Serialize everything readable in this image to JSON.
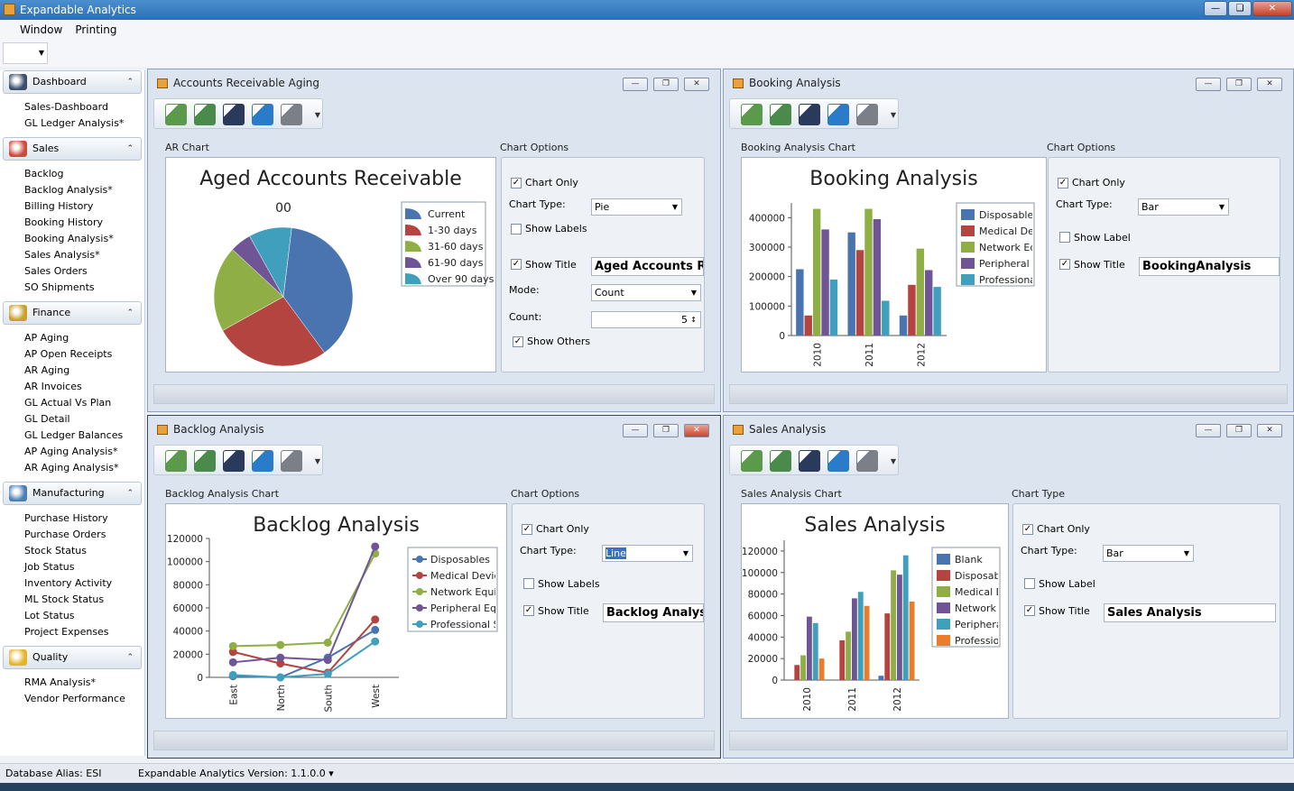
{
  "app": {
    "title": "Expandable Analytics"
  },
  "menu": [
    "Window",
    "Printing"
  ],
  "nav": [
    {
      "header": "Dashboard",
      "color": "#3b4f6b",
      "icon": "dashboard-gauge-icon",
      "items": [
        "Sales-Dashboard",
        "GL Ledger Analysis*"
      ]
    },
    {
      "header": "Sales",
      "color": "#d04a3a",
      "icon": "sales-bars-icon",
      "items": [
        "Backlog",
        "Backlog Analysis*",
        "Billing History",
        "Booking History",
        "Booking Analysis*",
        "Sales Analysis*",
        "Sales Orders",
        "SO Shipments"
      ]
    },
    {
      "header": "Finance",
      "color": "#c9a02b",
      "icon": "finance-money-icon",
      "items": [
        "AP Aging",
        "AP Open Receipts",
        "AR Aging",
        "AR Invoices",
        "GL Actual Vs Plan",
        "GL Detail",
        "GL Ledger Balances",
        "AP Aging Analysis*",
        "AR Aging Analysis*"
      ]
    },
    {
      "header": "Manufacturing",
      "color": "#4a7fb5",
      "icon": "manufacturing-gear-icon",
      "items": [
        "Purchase History",
        "Purchase Orders",
        "Stock Status",
        "Job Status",
        "Inventory Activity",
        "ML Stock Status",
        "Lot Status",
        "Project Expenses"
      ]
    },
    {
      "header": "Quality",
      "color": "#e2b52b",
      "icon": "quality-star-icon",
      "items": [
        "RMA Analysis*",
        "Vendor Performance"
      ]
    }
  ],
  "status": {
    "db": "Database Alias: ESI",
    "version": "Expandable Analytics Version: 1.1.0.0 ▾"
  },
  "windows": {
    "ar": {
      "title": "Accounts Receivable Aging",
      "chart_label": "AR Chart",
      "options_label": "Chart Options",
      "options": {
        "chart_only": "Chart Only",
        "chart_type_label": "Chart Type:",
        "chart_type": "Pie",
        "show_labels": "Show Labels",
        "show_title": "Show Title",
        "title_value": "Aged Accounts Rec",
        "mode_label": "Mode:",
        "mode": "Count",
        "count_label": "Count:",
        "count": "5",
        "show_others": "Show Others"
      }
    },
    "booking": {
      "title": "Booking Analysis",
      "chart_label": "Booking Analysis Chart",
      "options_label": "Chart Options",
      "options": {
        "chart_only": "Chart Only",
        "chart_type_label": "Chart Type:",
        "chart_type": "Bar",
        "show_label": "Show Label",
        "show_title": "Show Title",
        "title_value": "BookingAnalysis"
      }
    },
    "backlog": {
      "title": "Backlog Analysis",
      "chart_label": "Backlog Analysis Chart",
      "options_label": "Chart Options",
      "options": {
        "chart_only": "Chart Only",
        "chart_type_label": "Chart Type:",
        "chart_type": "Line",
        "show_labels": "Show Labels",
        "show_title": "Show Title",
        "title_value": "Backlog Analysis"
      }
    },
    "sales": {
      "title": "Sales Analysis",
      "chart_label": "Sales Analysis Chart",
      "options_label": "Chart Type",
      "options": {
        "chart_only": "Chart Only",
        "chart_type_label": "Chart Type:",
        "chart_type": "Bar",
        "show_label": "Show Label",
        "show_title": "Show Title",
        "title_value": "Sales Analysis"
      }
    }
  },
  "chart_data": [
    {
      "type": "pie",
      "title": "Aged Accounts Receivable",
      "subtitle": "00",
      "categories": [
        "Current",
        "1-30 days",
        "31-60 days",
        "61-90 days",
        "Over 90 days"
      ],
      "values": [
        38,
        27,
        20,
        5,
        10
      ],
      "colors": [
        "#4a74b0",
        "#b4443f",
        "#8fae45",
        "#6f5596",
        "#3f9fbd"
      ],
      "legend": "right"
    },
    {
      "type": "bar",
      "title": "Booking Analysis",
      "categories": [
        "2010",
        "2011",
        "2012"
      ],
      "ylim": [
        0,
        450000
      ],
      "yticks": [
        "0",
        "100000",
        "200000",
        "300000",
        "400000"
      ],
      "series": [
        {
          "name": "Disposables",
          "values": [
            225000,
            350000,
            68000
          ],
          "color": "#4a74b0"
        },
        {
          "name": "Medical Devi",
          "values": [
            68000,
            290000,
            172000
          ],
          "color": "#b4443f"
        },
        {
          "name": "Network Equ",
          "values": [
            430000,
            430000,
            295000
          ],
          "color": "#8fae45"
        },
        {
          "name": "Peripheral Ec",
          "values": [
            360000,
            395000,
            222000
          ],
          "color": "#6f5596"
        },
        {
          "name": "Professional",
          "values": [
            190000,
            118000,
            165000
          ],
          "color": "#3f9fbd"
        }
      ],
      "legend": "right"
    },
    {
      "type": "line",
      "title": "Backlog Analysis",
      "categories": [
        "East",
        "North",
        "South",
        "West"
      ],
      "ylim": [
        0,
        120000
      ],
      "yticks": [
        "0",
        "20000",
        "40000",
        "60000",
        "80000",
        "100000",
        "120000"
      ],
      "series": [
        {
          "name": "Disposables",
          "values": [
            1000,
            0,
            17000,
            41000
          ],
          "color": "#4a74b0"
        },
        {
          "name": "Medical Device",
          "values": [
            22000,
            12000,
            4000,
            50000
          ],
          "color": "#b4443f"
        },
        {
          "name": "Network Equipr",
          "values": [
            27000,
            28000,
            30000,
            107000
          ],
          "color": "#8fae45"
        },
        {
          "name": "Peripheral Equi",
          "values": [
            13000,
            17000,
            15000,
            113000
          ],
          "color": "#6f5596"
        },
        {
          "name": "Professional Se",
          "values": [
            2000,
            0,
            3000,
            31000
          ],
          "color": "#3f9fbd"
        }
      ],
      "legend": "right"
    },
    {
      "type": "bar",
      "title": "Sales Analysis",
      "categories": [
        "2010",
        "2011",
        "2012"
      ],
      "ylim": [
        0,
        130000
      ],
      "yticks": [
        "0",
        "20000",
        "40000",
        "60000",
        "80000",
        "100000",
        "120000"
      ],
      "series": [
        {
          "name": "Blank",
          "values": [
            0,
            0,
            4000
          ],
          "color": "#4a74b0"
        },
        {
          "name": "Disposable",
          "values": [
            14000,
            37000,
            62000
          ],
          "color": "#b4443f"
        },
        {
          "name": "Medical De",
          "values": [
            23000,
            45000,
            102000
          ],
          "color": "#8fae45"
        },
        {
          "name": "Network E",
          "values": [
            59000,
            76000,
            98000
          ],
          "color": "#6f5596"
        },
        {
          "name": "Peripheral",
          "values": [
            53000,
            82000,
            116000
          ],
          "color": "#3f9fbd"
        },
        {
          "name": "Profession",
          "values": [
            20000,
            69000,
            73000
          ],
          "color": "#e97d2b"
        }
      ],
      "legend": "right"
    }
  ]
}
